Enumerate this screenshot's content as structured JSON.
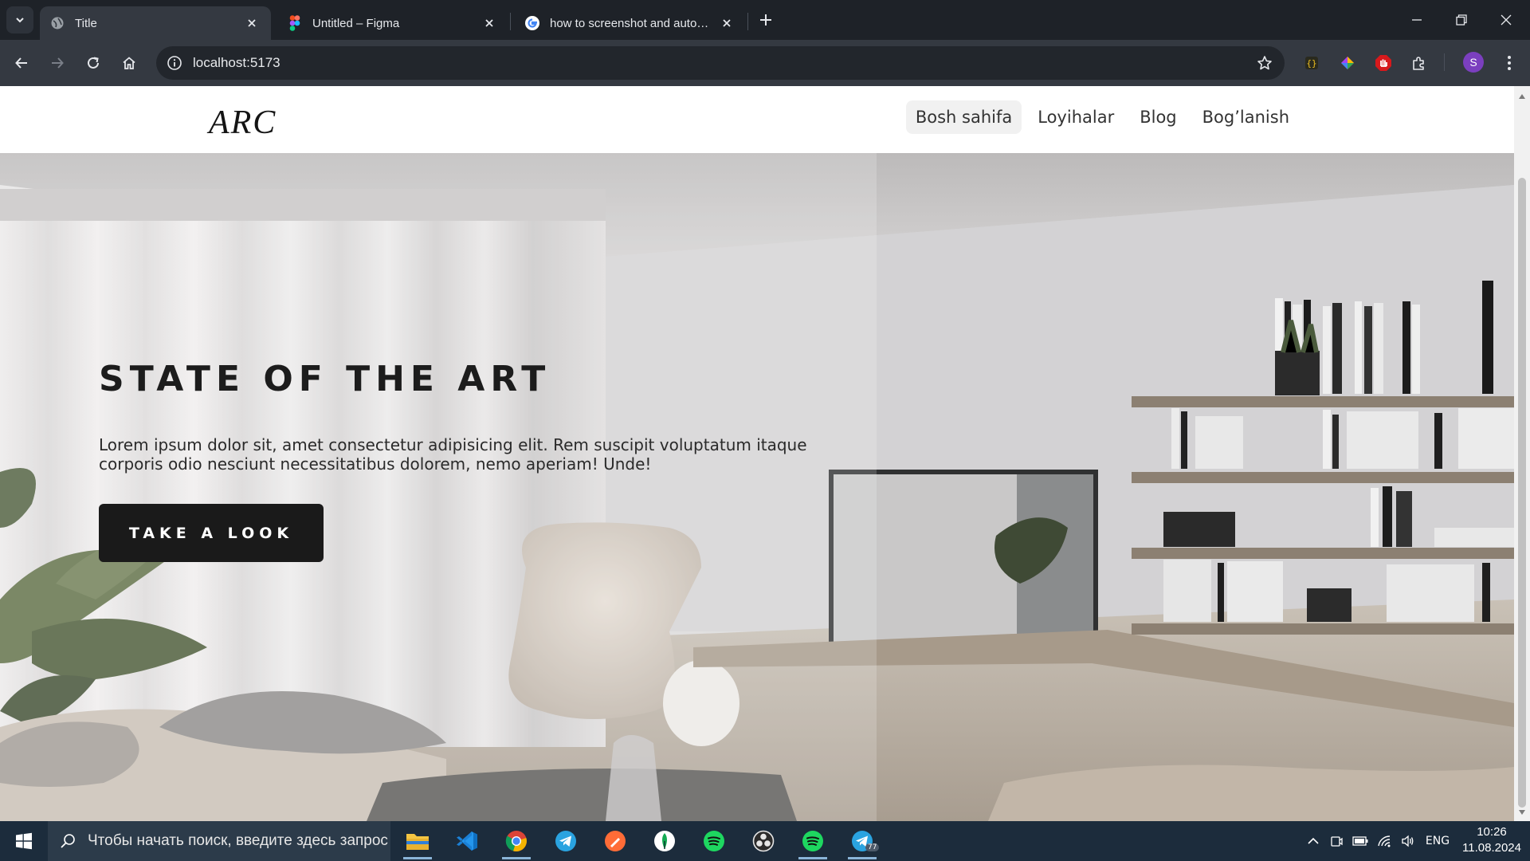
{
  "browser": {
    "tabs": [
      {
        "title": "Title",
        "icon": "globe-icon",
        "active": true
      },
      {
        "title": "Untitled – Figma",
        "icon": "figma-icon",
        "active": false
      },
      {
        "title": "how to screenshot and automat",
        "icon": "google-icon",
        "active": false
      }
    ],
    "url": "localhost:5173",
    "profile_initial": "S"
  },
  "site": {
    "logo": "ARC",
    "nav": [
      {
        "label": "Bosh sahifa",
        "active": true
      },
      {
        "label": "Loyihalar",
        "active": false
      },
      {
        "label": "Blog",
        "active": false
      },
      {
        "label": "Bog’lanish",
        "active": false
      }
    ],
    "hero": {
      "title": "STATE OF THE ART",
      "text": "Lorem ipsum dolor sit, amet consectetur adipisicing elit. Rem suscipit voluptatum itaque corporis odio nesciunt necessitatibus dolorem, nemo aperiam! Unde!",
      "button": "TAKE A LOOK"
    }
  },
  "taskbar": {
    "search_placeholder": "Чтобы начать поиск, введите здесь запрос",
    "language": "ENG",
    "time": "10:26",
    "date": "11.08.2024",
    "telegram_badge": "77"
  },
  "colors": {
    "tab_bar": "#1e2228",
    "toolbar": "#343941",
    "taskbar": "#1c2c3c",
    "hero_button": "#1a1a1a"
  }
}
